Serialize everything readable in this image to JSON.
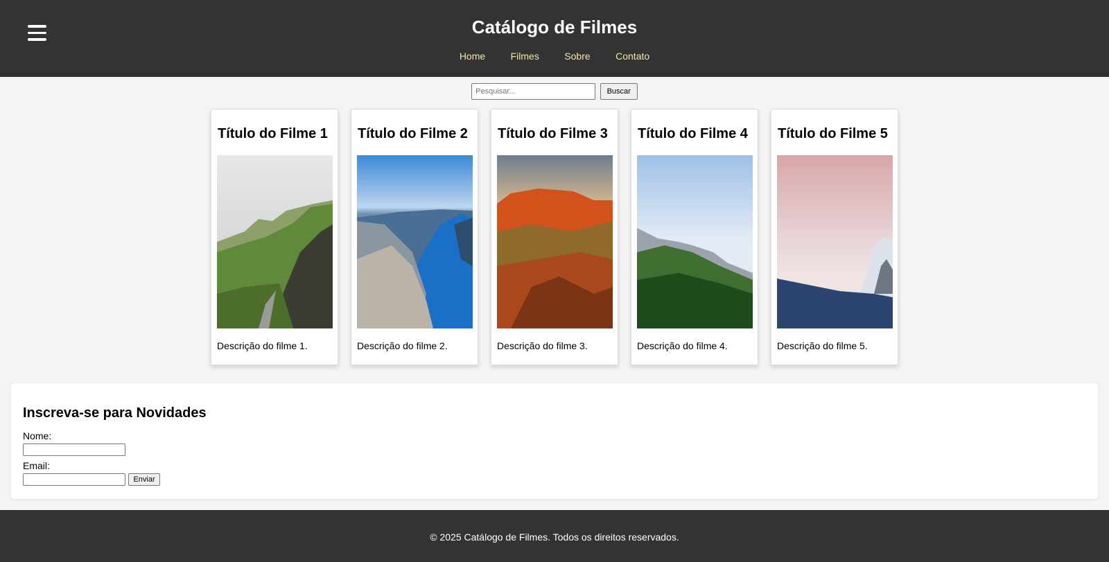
{
  "header": {
    "menu_icon": "hamburger-menu-icon",
    "title": "Catálogo de Filmes",
    "nav": [
      {
        "label": "Home"
      },
      {
        "label": "Filmes"
      },
      {
        "label": "Sobre"
      },
      {
        "label": "Contato"
      }
    ]
  },
  "search": {
    "placeholder": "Pesquisar...",
    "value": "",
    "button_label": "Buscar"
  },
  "movies": [
    {
      "title": "Título do Filme 1",
      "description": "Descrição do filme 1.",
      "image": "green-mountain-road-landscape"
    },
    {
      "title": "Título do Filme 2",
      "description": "Descrição do filme 2.",
      "image": "blue-fjord-cliffs-landscape"
    },
    {
      "title": "Título do Filme 3",
      "description": "Descrição do filme 3.",
      "image": "orange-sunset-rocky-mesa-landscape"
    },
    {
      "title": "Título do Filme 4",
      "description": "Descrição do filme 4.",
      "image": "pine-forest-mountains-landscape"
    },
    {
      "title": "Título do Filme 5",
      "description": "Descrição do filme 5.",
      "image": "pink-sky-snowy-peak-landscape"
    }
  ],
  "newsletter": {
    "heading": "Inscreva-se para Novidades",
    "name_label": "Nome:",
    "name_value": "",
    "email_label": "Email:",
    "email_value": "",
    "submit_label": "Enviar"
  },
  "footer": {
    "text": "© 2025 Catálogo de Filmes. Todos os direitos reservados."
  },
  "colors": {
    "header_bg": "#333333",
    "nav_link": "#f2e6a8",
    "page_bg": "#f4f4f4",
    "card_bg": "#ffffff"
  }
}
